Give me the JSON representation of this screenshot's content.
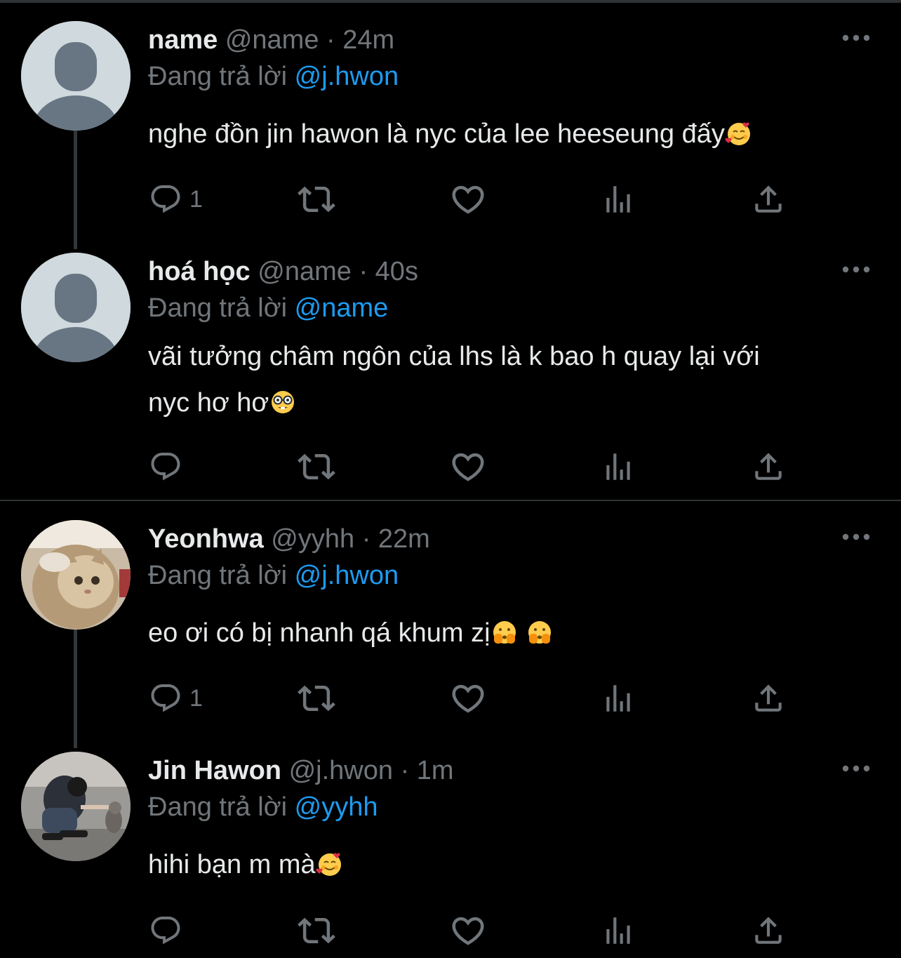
{
  "colors": {
    "background": "#000000",
    "primary_text": "#e7e9ea",
    "secondary_text": "#71767b",
    "link": "#1d9bf0",
    "divider": "#2f3336"
  },
  "reply_prefix": "Đang trả lời",
  "tweets": [
    {
      "display_name": "name",
      "handle": "@name",
      "separator": "·",
      "time": "24m",
      "replying_to": "@j.hwon",
      "text": "nghe đồn jin hawon là nyc của lee heeseung đấy",
      "emoji": "smiling-face-with-hearts",
      "reply_count": "1",
      "avatar": "default-avatar-icon"
    },
    {
      "display_name": "hoá học",
      "handle": "@name",
      "separator": "·",
      "time": "40s",
      "replying_to": "@name",
      "text_line1": "vãi tưởng châm ngôn của lhs là k bao h quay lại với",
      "text_line2": "nyc hơ hơ",
      "emoji": "nerd-face",
      "reply_count": "",
      "avatar": "default-avatar-icon"
    },
    {
      "display_name": "Yeonhwa",
      "handle": "@yyhh",
      "separator": "·",
      "time": "22m",
      "replying_to": "@j.hwon",
      "text": "eo ơi có bị nhanh qá khum zị",
      "emoji": "face-with-open-eyes-and-hand-over-mouth",
      "reply_count": "1",
      "avatar": "cat-photo"
    },
    {
      "display_name": "Jin Hawon",
      "handle": "@j.hwon",
      "separator": "·",
      "time": "1m",
      "replying_to": "@yyhh",
      "text": "hihi bạn m mà",
      "emoji": "smiling-face-with-hearts",
      "reply_count": "",
      "avatar": "person-petting-cat-photo"
    }
  ]
}
